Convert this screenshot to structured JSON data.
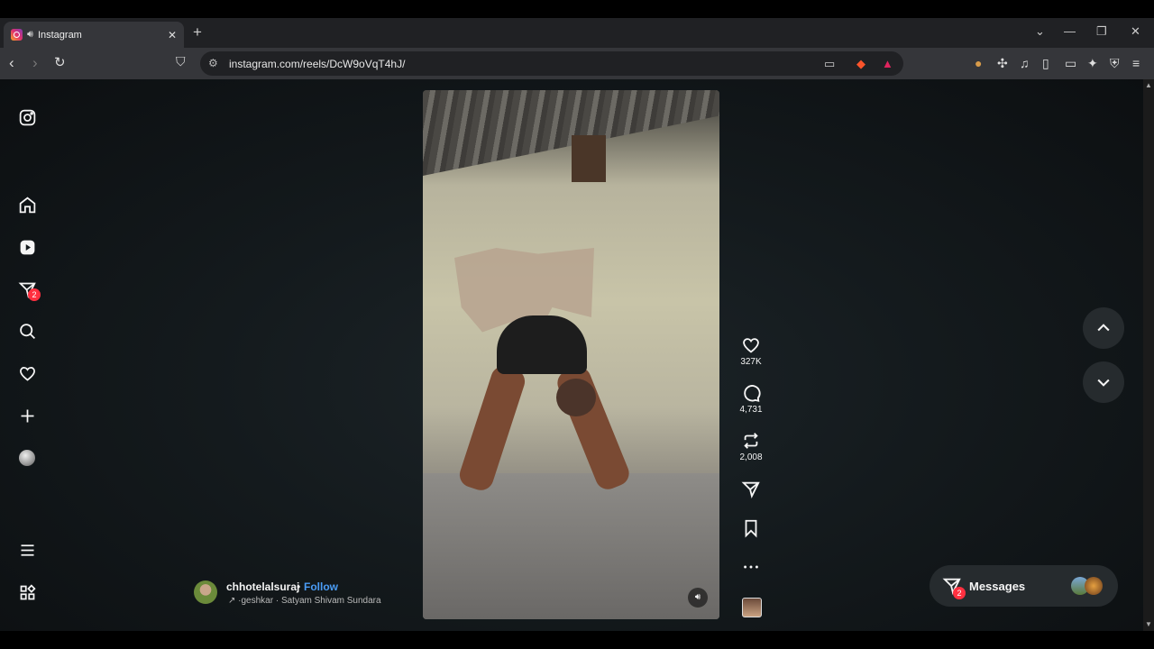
{
  "browser": {
    "tab_title": "Instagram",
    "tab_audio_icon": "speaker-icon",
    "url": "instagram.com/reels/DcW9oVqT4hJ/",
    "tab_close": "✕",
    "new_tab": "+"
  },
  "sidebar": {
    "notifications_badge": "2"
  },
  "reel": {
    "author": "chhotelalsuraj",
    "separator": "•",
    "follow_label": "Follow",
    "audio_text": "↗  ·geshkar · Satyam Shivam Sundara",
    "likes": "327K",
    "comments": "4,731",
    "reposts": "2,008"
  },
  "messages": {
    "label": "Messages",
    "badge": "2"
  },
  "colors": {
    "accent_link": "#4a9cf5",
    "badge": "#ff3040",
    "page_bg": "#141a1d"
  }
}
